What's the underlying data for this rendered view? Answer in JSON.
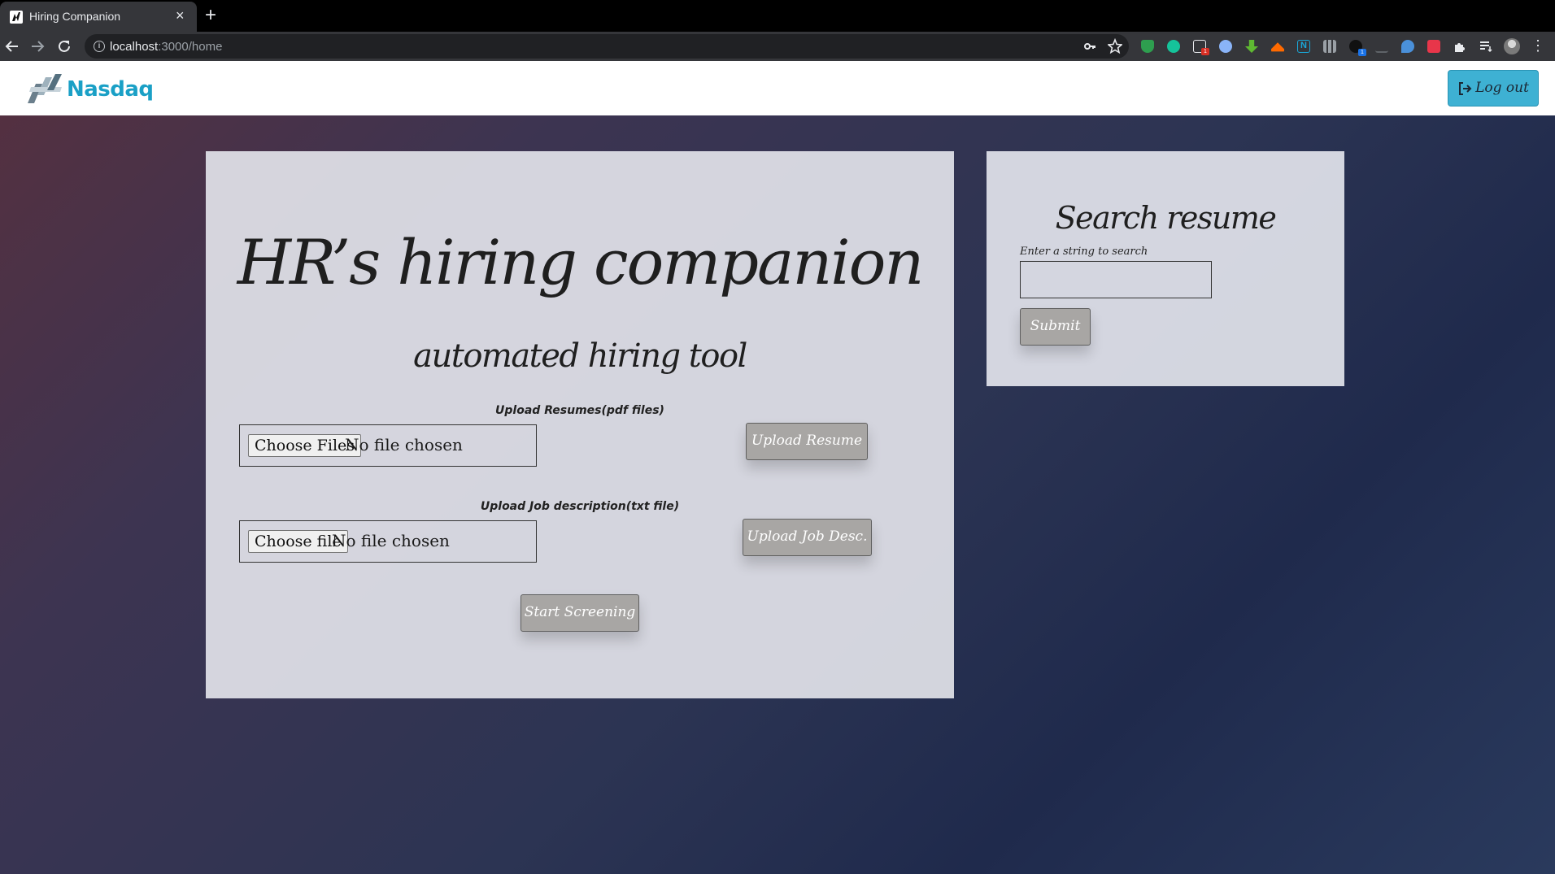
{
  "browser": {
    "tab_title": "Hiring Companion",
    "tab_close": "×",
    "new_tab": "+",
    "url_host": "localhost",
    "url_path": ":3000/home",
    "icons": [
      "back-icon",
      "forward-icon",
      "reload-icon",
      "info-icon",
      "key-icon",
      "star-icon",
      "extensions-icon",
      "menu-icon"
    ]
  },
  "navbar": {
    "logo_text": "Nasdaq",
    "logout_label": "Log out",
    "accent": "#3eb1d3"
  },
  "main": {
    "title": "HR’s hiring companion",
    "subtitle": "automated hiring tool",
    "resume_section": {
      "label": "Upload Resumes(pdf files)",
      "choose_label": "Choose Files",
      "status": "No file chosen",
      "upload_button": "Upload Resume"
    },
    "job_section": {
      "label": "Upload Job description(txt file)",
      "choose_label": "Choose file",
      "status": "No file chosen",
      "upload_button": "Upload Job Desc."
    },
    "start_button": "Start Screening"
  },
  "search": {
    "title": "Search resume",
    "label": "Enter a string to search",
    "value": "",
    "submit_label": "Submit"
  }
}
